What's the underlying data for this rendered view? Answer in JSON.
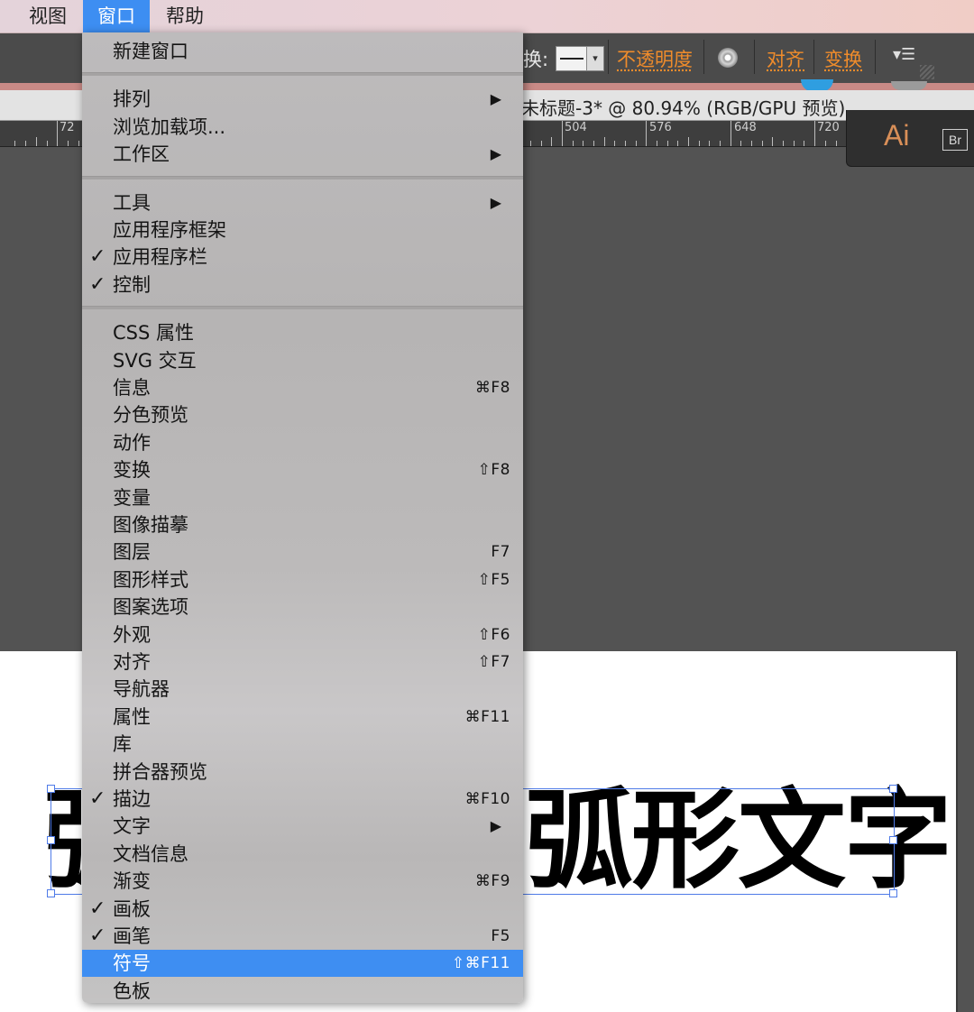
{
  "menubar": {
    "items": [
      {
        "label": "视图"
      },
      {
        "label": "窗口"
      },
      {
        "label": "帮助"
      }
    ]
  },
  "control_bar": {
    "stroke_label": "换:",
    "opacity_link": "不透明度",
    "align_link": "对齐",
    "transform_link": "变换"
  },
  "document": {
    "title": "未标题-3* @ 80.94% (RGB/GPU 预览)"
  },
  "ruler": {
    "labels": [
      "72",
      "504",
      "576",
      "648",
      "720"
    ]
  },
  "app_badges": {
    "ai": "Ai",
    "br": "Br"
  },
  "artboard": {
    "text": "弧形文字"
  },
  "window_menu": {
    "groups": [
      [
        {
          "label": "新建窗口",
          "checked": false,
          "shortcut": "",
          "submenu": false
        }
      ],
      [
        {
          "label": "排列",
          "checked": false,
          "shortcut": "",
          "submenu": true
        },
        {
          "label": "浏览加载项...",
          "checked": false,
          "shortcut": "",
          "submenu": false
        },
        {
          "label": "工作区",
          "checked": false,
          "shortcut": "",
          "submenu": true
        }
      ],
      [
        {
          "label": "工具",
          "checked": false,
          "shortcut": "",
          "submenu": true
        },
        {
          "label": "应用程序框架",
          "checked": false,
          "shortcut": "",
          "submenu": false
        },
        {
          "label": "应用程序栏",
          "checked": true,
          "shortcut": "",
          "submenu": false
        },
        {
          "label": "控制",
          "checked": true,
          "shortcut": "",
          "submenu": false
        }
      ],
      [
        {
          "label": "CSS 属性",
          "checked": false,
          "shortcut": "",
          "submenu": false
        },
        {
          "label": "SVG 交互",
          "checked": false,
          "shortcut": "",
          "submenu": false
        },
        {
          "label": "信息",
          "checked": false,
          "shortcut": "⌘F8",
          "submenu": false
        },
        {
          "label": "分色预览",
          "checked": false,
          "shortcut": "",
          "submenu": false
        },
        {
          "label": "动作",
          "checked": false,
          "shortcut": "",
          "submenu": false
        },
        {
          "label": "变换",
          "checked": false,
          "shortcut": "⇧F8",
          "submenu": false
        },
        {
          "label": "变量",
          "checked": false,
          "shortcut": "",
          "submenu": false
        },
        {
          "label": "图像描摹",
          "checked": false,
          "shortcut": "",
          "submenu": false
        },
        {
          "label": "图层",
          "checked": false,
          "shortcut": "F7",
          "submenu": false
        },
        {
          "label": "图形样式",
          "checked": false,
          "shortcut": "⇧F5",
          "submenu": false
        },
        {
          "label": "图案选项",
          "checked": false,
          "shortcut": "",
          "submenu": false
        },
        {
          "label": "外观",
          "checked": false,
          "shortcut": "⇧F6",
          "submenu": false
        },
        {
          "label": "对齐",
          "checked": false,
          "shortcut": "⇧F7",
          "submenu": false
        },
        {
          "label": "导航器",
          "checked": false,
          "shortcut": "",
          "submenu": false
        },
        {
          "label": "属性",
          "checked": false,
          "shortcut": "⌘F11",
          "submenu": false
        },
        {
          "label": "库",
          "checked": false,
          "shortcut": "",
          "submenu": false
        },
        {
          "label": "拼合器预览",
          "checked": false,
          "shortcut": "",
          "submenu": false
        },
        {
          "label": "描边",
          "checked": true,
          "shortcut": "⌘F10",
          "submenu": false
        },
        {
          "label": "文字",
          "checked": false,
          "shortcut": "",
          "submenu": true
        },
        {
          "label": "文档信息",
          "checked": false,
          "shortcut": "",
          "submenu": false
        },
        {
          "label": "渐变",
          "checked": false,
          "shortcut": "⌘F9",
          "submenu": false
        },
        {
          "label": "画板",
          "checked": true,
          "shortcut": "",
          "submenu": false
        },
        {
          "label": "画笔",
          "checked": true,
          "shortcut": "F5",
          "submenu": false
        },
        {
          "label": "符号",
          "checked": false,
          "shortcut": "⇧⌘F11",
          "submenu": false,
          "highlighted": true
        },
        {
          "label": "色板",
          "checked": false,
          "shortcut": "",
          "submenu": false
        }
      ]
    ]
  },
  "colors": {
    "accent": "#3e8ef2",
    "menu_bg": "#bdbbbc",
    "link_orange": "#f08c2b",
    "canvas_bg": "#535353"
  }
}
